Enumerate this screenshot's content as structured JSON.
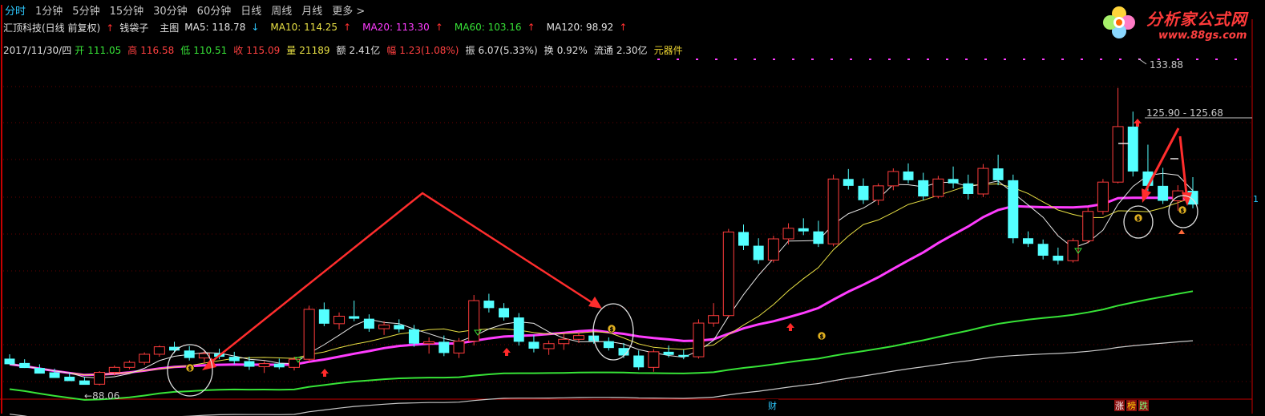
{
  "toolbar": {
    "tabs": [
      "分时",
      "1分钟",
      "5分钟",
      "15分钟",
      "30分钟",
      "60分钟",
      "日线",
      "周线",
      "月线",
      "更多"
    ],
    "more_arrow": ">"
  },
  "stock": {
    "name": "汇顶科技(日线 前复权)",
    "indicator": "钱袋子",
    "main_label": "主图",
    "ma": [
      {
        "label": "MA5: 118.78",
        "dir": "↓",
        "color": "#e6e6e6"
      },
      {
        "label": "MA10: 114.25",
        "dir": "↑",
        "color": "#e8e044"
      },
      {
        "label": "MA20: 113.30",
        "dir": "↑",
        "color": "#ff3cff"
      },
      {
        "label": "MA60: 103.16",
        "dir": "↑",
        "color": "#37e337"
      },
      {
        "label": "MA120: 98.92",
        "dir": "↑",
        "color": "#c8c8c8"
      }
    ]
  },
  "quote": {
    "date": "2017/11/30/四",
    "open_label": "开",
    "open": "111.05",
    "high_label": "高",
    "high": "116.58",
    "low_label": "低",
    "low": "110.51",
    "close_label": "收",
    "close": "115.09",
    "vol_label": "量",
    "vol": "21189",
    "amt_label": "额",
    "amt": "2.41亿",
    "chg_label": "幅",
    "chg": "1.23(1.08%)",
    "amp_label": "振",
    "amp": "6.07(5.33%)",
    "turn_label": "换",
    "turn": "0.92%",
    "float_label": "流通",
    "float": "2.30亿",
    "sector": "元器件"
  },
  "annotations": {
    "high_price": "133.88",
    "range": "125.90 - 125.68",
    "low_price": "88.06",
    "right_edge": "1"
  },
  "bottom_marks": {
    "cai": "财",
    "zhang": "涨",
    "bang": "榜",
    "die": "跌"
  },
  "logo": {
    "text": "分析家公式网",
    "url": "www.88gs.com"
  },
  "colors": {
    "up": "#ff3c3c",
    "down": "#54ffff",
    "ma5": "#e6e6e6",
    "ma10": "#e8e044",
    "ma20": "#ff3cff",
    "ma60": "#37e337",
    "ma120": "#c8c8c8",
    "arrow": "#ff3030"
  },
  "chart_data": {
    "type": "candlestick",
    "y_range": [
      85,
      140
    ],
    "candles": [
      [
        91.5,
        92.2,
        90.8,
        90.6
      ],
      [
        90.8,
        91.4,
        90.0,
        90.0
      ],
      [
        90.0,
        90.6,
        89.3,
        89.1
      ],
      [
        89.3,
        89.9,
        88.6,
        88.4
      ],
      [
        88.6,
        89.2,
        88.0,
        87.9
      ],
      [
        88.0,
        88.6,
        87.4,
        87.3
      ],
      [
        87.4,
        89.5,
        87.2,
        89.3
      ],
      [
        89.3,
        90.4,
        88.8,
        90.1
      ],
      [
        90.1,
        91.2,
        89.8,
        90.9
      ],
      [
        90.9,
        92.5,
        90.5,
        92.2
      ],
      [
        92.2,
        93.6,
        91.8,
        93.4
      ],
      [
        93.4,
        94.2,
        92.4,
        92.8
      ],
      [
        92.8,
        93.5,
        91.2,
        91.6
      ],
      [
        91.6,
        92.7,
        90.8,
        92.3
      ],
      [
        92.3,
        93.1,
        91.4,
        91.8
      ],
      [
        91.8,
        92.6,
        90.6,
        91.1
      ],
      [
        91.1,
        91.8,
        89.7,
        90.2
      ],
      [
        90.2,
        91.1,
        89.2,
        90.7
      ],
      [
        90.7,
        91.5,
        89.8,
        90.1
      ],
      [
        90.1,
        91.8,
        89.6,
        91.4
      ],
      [
        91.4,
        100.0,
        90.9,
        99.4
      ],
      [
        99.4,
        100.5,
        96.7,
        97.1
      ],
      [
        97.1,
        98.9,
        96.2,
        98.3
      ],
      [
        98.3,
        100.8,
        97.5,
        97.9
      ],
      [
        97.9,
        98.6,
        95.8,
        96.3
      ],
      [
        96.3,
        97.5,
        95.3,
        96.9
      ],
      [
        96.9,
        97.8,
        95.7,
        96.2
      ],
      [
        96.2,
        96.9,
        93.4,
        93.9
      ],
      [
        93.9,
        94.9,
        92.3,
        94.2
      ],
      [
        94.2,
        95.2,
        91.9,
        92.4
      ],
      [
        92.4,
        94.8,
        91.6,
        94.3
      ],
      [
        94.3,
        101.7,
        93.6,
        100.8
      ],
      [
        100.8,
        101.9,
        98.9,
        99.6
      ],
      [
        99.6,
        100.4,
        97.6,
        98.1
      ],
      [
        98.1,
        98.8,
        93.6,
        94.2
      ],
      [
        94.2,
        95.3,
        92.5,
        93.1
      ],
      [
        93.1,
        94.4,
        92.1,
        93.9
      ],
      [
        93.9,
        95.4,
        92.9,
        94.6
      ],
      [
        94.6,
        95.6,
        94.0,
        95.2
      ],
      [
        95.2,
        95.8,
        93.9,
        94.3
      ],
      [
        94.3,
        94.9,
        92.8,
        93.2
      ],
      [
        93.2,
        94.0,
        91.6,
        92.0
      ],
      [
        92.0,
        92.8,
        89.7,
        90.1
      ],
      [
        90.1,
        93.0,
        89.4,
        92.6
      ],
      [
        92.6,
        93.6,
        91.7,
        92.1
      ],
      [
        92.1,
        92.9,
        91.4,
        91.8
      ],
      [
        91.8,
        97.8,
        91.5,
        97.2
      ],
      [
        97.2,
        100.4,
        96.6,
        98.4
      ],
      [
        98.4,
        112.3,
        98.1,
        111.8
      ],
      [
        111.8,
        113.0,
        108.9,
        109.6
      ],
      [
        109.6,
        110.8,
        106.7,
        107.3
      ],
      [
        107.3,
        111.2,
        106.9,
        110.7
      ],
      [
        110.7,
        113.2,
        109.8,
        112.4
      ],
      [
        112.4,
        114.0,
        111.3,
        111.9
      ],
      [
        111.9,
        113.6,
        109.4,
        109.9
      ],
      [
        109.9,
        121.0,
        109.5,
        120.3
      ],
      [
        120.3,
        121.9,
        118.6,
        119.2
      ],
      [
        119.2,
        120.4,
        116.3,
        116.9
      ],
      [
        116.9,
        119.6,
        116.1,
        119.2
      ],
      [
        119.2,
        122.0,
        118.5,
        121.5
      ],
      [
        121.5,
        122.8,
        119.6,
        120.1
      ],
      [
        120.1,
        121.3,
        116.9,
        117.5
      ],
      [
        117.5,
        120.8,
        117.2,
        120.3
      ],
      [
        120.3,
        122.3,
        118.8,
        119.6
      ],
      [
        119.6,
        121.0,
        117.0,
        117.9
      ],
      [
        117.9,
        122.7,
        117.4,
        122.0
      ],
      [
        122.0,
        124.2,
        119.3,
        120.1
      ],
      [
        120.1,
        121.0,
        110.0,
        110.8
      ],
      [
        110.8,
        111.9,
        109.4,
        109.9
      ],
      [
        109.9,
        110.6,
        107.4,
        108.0
      ],
      [
        108.0,
        109.3,
        106.6,
        107.2
      ],
      [
        107.2,
        110.8,
        106.9,
        110.4
      ],
      [
        110.4,
        115.7,
        110.0,
        115.1
      ],
      [
        115.1,
        120.3,
        114.6,
        119.8
      ],
      [
        119.8,
        134.9,
        119.6,
        128.7
      ],
      [
        128.7,
        131.1,
        120.7,
        121.5
      ],
      [
        121.5,
        125.8,
        118.4,
        119.2
      ],
      [
        119.2,
        122.1,
        116.3,
        116.8
      ],
      [
        116.8,
        119.3,
        115.2,
        118.4
      ],
      [
        118.4,
        120.6,
        115.6,
        116.2
      ]
    ]
  }
}
